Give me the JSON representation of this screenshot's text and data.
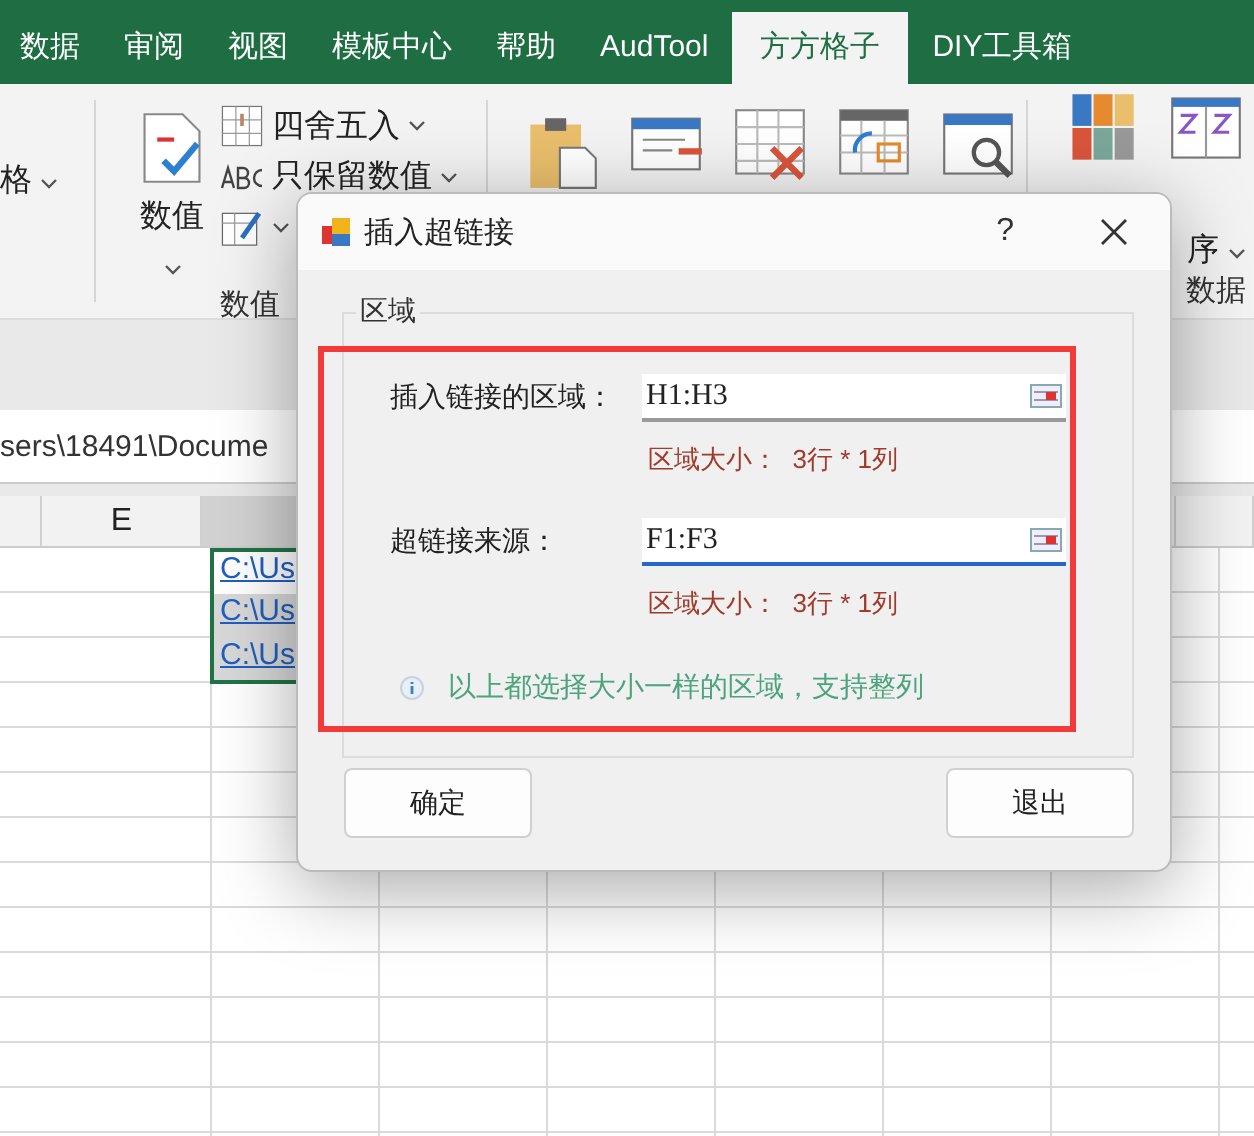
{
  "ribbon_tabs": [
    {
      "label": "数据",
      "selected": false
    },
    {
      "label": "审阅",
      "selected": false
    },
    {
      "label": "视图",
      "selected": false
    },
    {
      "label": "模板中心",
      "selected": false
    },
    {
      "label": "帮助",
      "selected": false
    },
    {
      "label": "AudTool",
      "selected": false
    },
    {
      "label": "方方格子",
      "selected": true
    },
    {
      "label": "DIY工具箱",
      "selected": false
    }
  ],
  "ribbon": {
    "left_item": "格",
    "numeric_button": "数值",
    "menu_items": [
      "四舍五入",
      "只保留数值"
    ],
    "group_labels": [
      "数值",
      "数据"
    ],
    "sort_tail": "序"
  },
  "formula_bar": {
    "value": "sers\\18491\\Docume"
  },
  "sheet": {
    "column_header": "E",
    "link_cells": [
      {
        "text": "C:\\Us",
        "active": true
      },
      {
        "text": "C:\\Us",
        "active": false
      },
      {
        "text": "C:\\Us",
        "active": false
      }
    ]
  },
  "dialog": {
    "title": "插入超链接",
    "help": "?",
    "group_title": "区域",
    "fields": [
      {
        "label": "插入链接的区域：",
        "value": "H1:H3",
        "size_text": "区域大小：  3行 * 1列",
        "focused": false
      },
      {
        "label": "超链接来源：",
        "value": "F1:F3",
        "size_text": "区域大小：  3行 * 1列",
        "focused": true
      }
    ],
    "info": "以上都选择大小一样的区域，支持整列",
    "buttons": [
      "确定",
      "退出"
    ]
  }
}
